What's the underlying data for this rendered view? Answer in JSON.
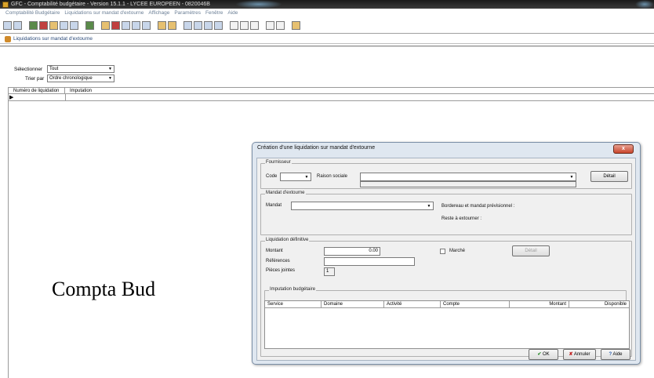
{
  "window": {
    "title": "GFC - Comptabilité budgétaire - Version 15.1.1 - LYCEE EUROPEEN - 0820046B"
  },
  "menu": [
    "Comptabilité Budgétaire",
    "Liquidations sur mandat d'extourne",
    "Affichage",
    "Paramètres",
    "Fenêtre",
    "Aide"
  ],
  "child": {
    "title": "Liquidations sur mandat d'extourne",
    "select_label": "Sélectionner",
    "select_value": "Tout",
    "sort_label": "Trier par",
    "sort_value": "Ordre chronologique",
    "columns": [
      "Numéro de liquidation",
      "Imputation"
    ]
  },
  "overlay_text": "Compta Bud",
  "dialog": {
    "title": "Création d'une liquidation sur mandat d'extourne",
    "close": "x",
    "fournisseur": {
      "group": "Fournisseur",
      "code_label": "Code",
      "code_value": "",
      "raison_label": "Raison sociale",
      "raison_value": "",
      "detail_button": "Détail"
    },
    "mandat": {
      "group": "Mandat d'extourne",
      "mandat_label": "Mandat",
      "mandat_value": "",
      "bordereau_label": "Bordereau et mandat prévisionnel :",
      "reste_label": "Reste à extourner :"
    },
    "liquidation": {
      "group": "Liquidation définitive",
      "montant_label": "Montant",
      "montant_value": "0.00",
      "references_label": "Références",
      "references_value": "",
      "pieces_label": "Pièces jointes",
      "pieces_value": "1",
      "marche_label": "Marché",
      "detail_button": "Détail"
    },
    "imputation": {
      "group": "Imputation budgétaire",
      "columns": [
        "Service",
        "Domaine",
        "Activité",
        "Compte",
        "Montant",
        "Disponible"
      ]
    },
    "buttons": {
      "ok": "OK",
      "cancel": "Annuler",
      "help": "Aide"
    }
  },
  "colors": {
    "title_bar": "#2a2a2a",
    "menu_text": "#6b7f96",
    "dialog_frame": "#dfe7f0",
    "close_button": "#c9462c"
  },
  "icons": [
    "app-icon",
    "toolbar-icons",
    "window-icon",
    "ok-check-icon",
    "cancel-x-icon",
    "help-question-icon"
  ]
}
